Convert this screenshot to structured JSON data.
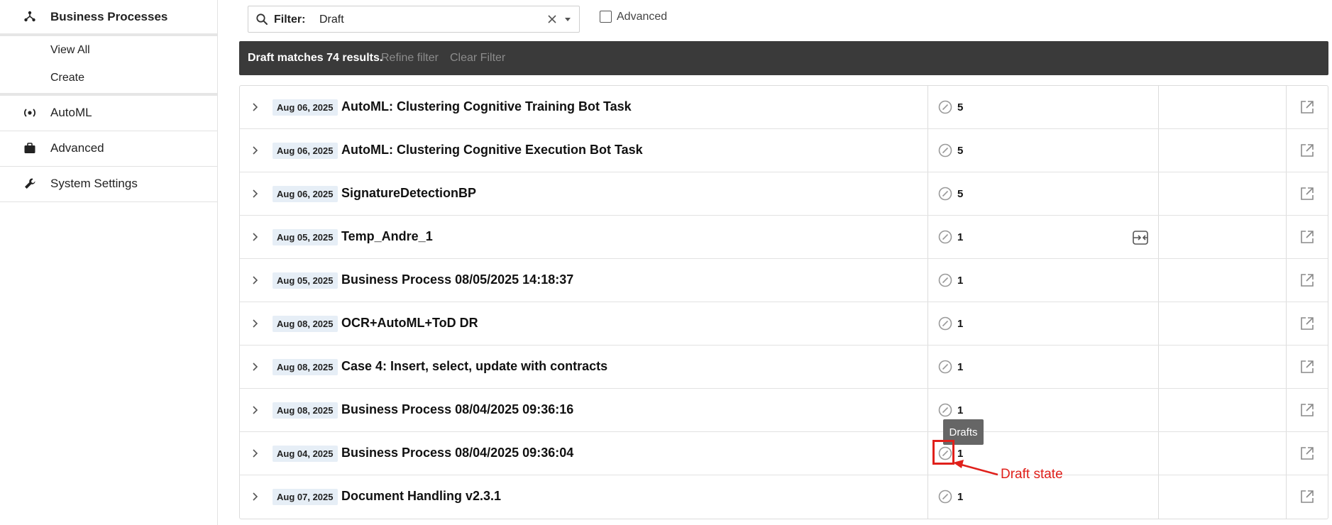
{
  "sidebar": {
    "sections": [
      {
        "label": "Business Processes",
        "icon": "hierarchy-icon",
        "active": true
      },
      {
        "label": "AutoML",
        "icon": "automl-icon"
      },
      {
        "label": "Advanced",
        "icon": "briefcase-icon"
      },
      {
        "label": "System Settings",
        "icon": "wrench-icon"
      }
    ],
    "sub_items": [
      {
        "label": "View All"
      },
      {
        "label": "Create"
      }
    ]
  },
  "filter": {
    "label": "Filter:",
    "value": "Draft",
    "advanced_label": "Advanced",
    "advanced_checked": false
  },
  "results": {
    "summary": "Draft matches 74 results.",
    "refine_label": "Refine filter",
    "clear_label": "Clear Filter"
  },
  "rows": [
    {
      "date": "Aug 06, 2025",
      "name": "AutoML: Clustering Cognitive Training Bot Task",
      "count": "5",
      "has_action": false
    },
    {
      "date": "Aug 06, 2025",
      "name": "AutoML: Clustering Cognitive Execution Bot Task",
      "count": "5",
      "has_action": false
    },
    {
      "date": "Aug 06, 2025",
      "name": "SignatureDetectionBP",
      "count": "5",
      "has_action": false
    },
    {
      "date": "Aug 05, 2025",
      "name": "Temp_Andre_1",
      "count": "1",
      "has_action": true
    },
    {
      "date": "Aug 05, 2025",
      "name": "Business Process 08/05/2025 14:18:37",
      "count": "1",
      "has_action": false
    },
    {
      "date": "Aug 08, 2025",
      "name": "OCR+AutoML+ToD DR",
      "count": "1",
      "has_action": false
    },
    {
      "date": "Aug 08, 2025",
      "name": "Case 4: Insert, select, update with contracts",
      "count": "1",
      "has_action": false
    },
    {
      "date": "Aug 08, 2025",
      "name": "Business Process 08/04/2025 09:36:16",
      "count": "1",
      "has_action": false
    },
    {
      "date": "Aug 04, 2025",
      "name": "Business Process 08/04/2025 09:36:04",
      "count": "1",
      "has_action": false
    },
    {
      "date": "Aug 07, 2025",
      "name": "Document Handling v2.3.1",
      "count": "1",
      "has_action": false
    }
  ],
  "tooltip": {
    "text": "Drafts"
  },
  "annotation": {
    "text": "Draft state",
    "color": "#e0201b"
  },
  "colors": {
    "results_bar": "#3a3a3a",
    "date_badge": "#e6eef6",
    "annotation": "#e0201b"
  }
}
